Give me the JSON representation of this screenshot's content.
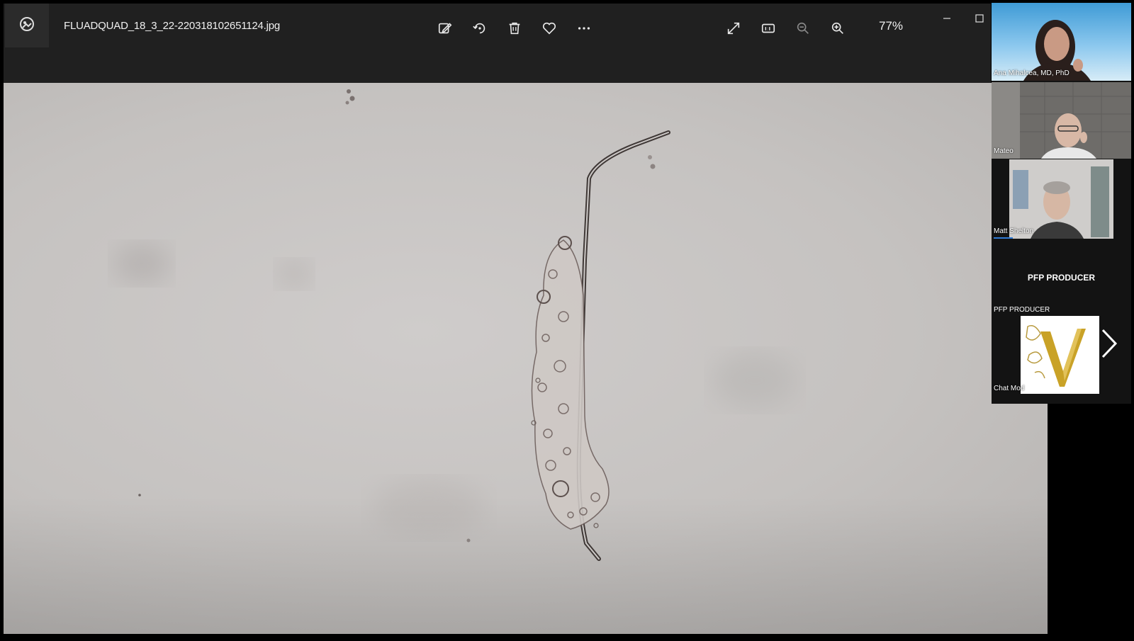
{
  "viewer": {
    "filename": "FLUADQUAD_18_3_22-220318102651124.jpg",
    "zoom": "77%",
    "toolbar_icons": [
      "edit-icon",
      "rotate-icon",
      "delete-icon",
      "favorite-icon",
      "more-icon",
      "fullscreen-icon",
      "actual-size-icon",
      "zoom-out-icon",
      "zoom-in-icon"
    ]
  },
  "participants": [
    {
      "name": "Ana Mihalcea, MD, PhD"
    },
    {
      "name": "Mateo"
    },
    {
      "name": "Matt Shelton"
    }
  ],
  "producer": {
    "title": "PFP PRODUCER",
    "subtitle": "PFP PRODUCER",
    "chat_label": "Chat Mod",
    "logo_letter": "V"
  },
  "colors": {
    "toolbar_bg": "#202020",
    "canvas_bg": "#c8c5c3",
    "panel_bg": "#131313",
    "logo_gold": "#c9a227"
  }
}
